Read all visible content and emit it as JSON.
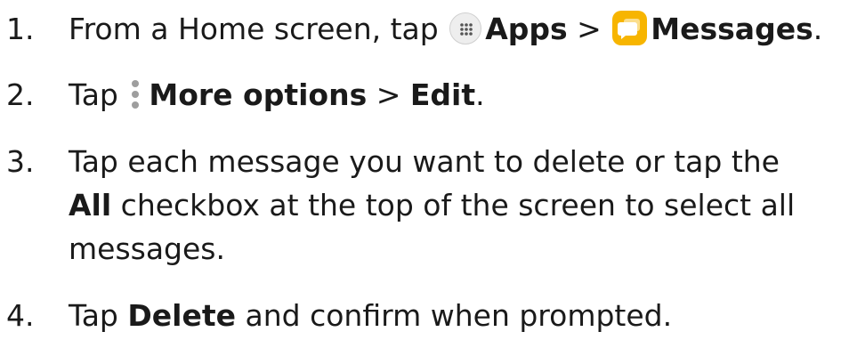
{
  "steps": [
    {
      "number": "1.",
      "text_before": "From a Home screen, tap",
      "apps_label": "Apps",
      "separator": ">",
      "messages_label": "Messages",
      "end": "."
    },
    {
      "number": "2.",
      "text_before": "Tap",
      "more_label": "More options",
      "separator": ">",
      "edit_label": "Edit",
      "end": "."
    },
    {
      "number": "3.",
      "line1": "Tap each message you want to delete or tap the",
      "all_label": "All",
      "line2_rest": "checkbox at the top of the screen to select all",
      "line3": "messages."
    },
    {
      "number": "4.",
      "text_before": "Tap",
      "delete_label": "Delete",
      "text_after": "and confirm when prompted."
    }
  ],
  "icons": {
    "apps": "apps-grid-icon",
    "messages": "messages-chat-icon",
    "more": "more-options-vertical-icon"
  },
  "colors": {
    "text": "#1a1a1a",
    "messages_icon_bg": "#f7b500",
    "more_dots": "#9e9e9e"
  }
}
